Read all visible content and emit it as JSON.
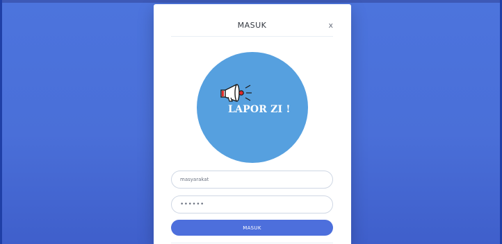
{
  "modal": {
    "title": "MASUK",
    "close_label": "x"
  },
  "logo": {
    "text": "LAPOR ZI !",
    "icon": "megaphone-icon",
    "circle_color": "#56a0df"
  },
  "form": {
    "username_value": "masyarakat",
    "password_value": "••••••",
    "submit_label": "MASUK"
  },
  "colors": {
    "background": "#4a6fd8",
    "button": "#4d6fdc"
  }
}
